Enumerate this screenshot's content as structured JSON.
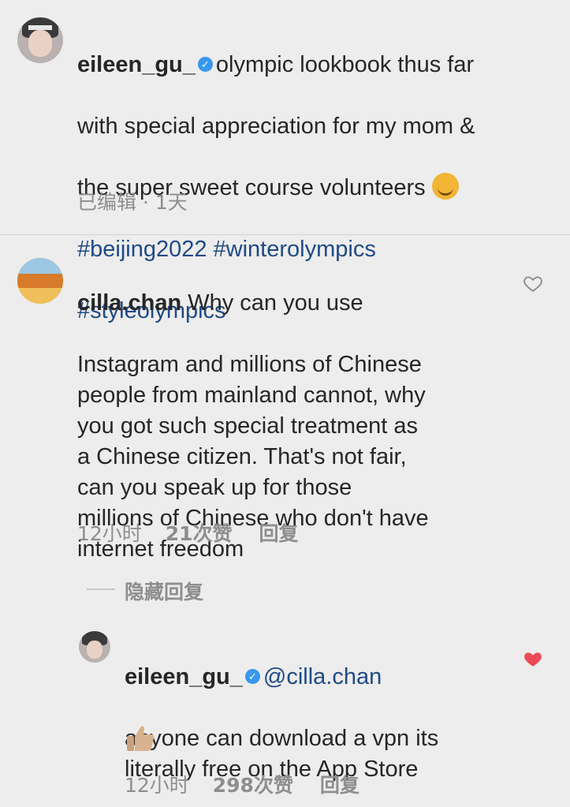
{
  "post": {
    "username": "eileen_gu_",
    "verified_icon": "verified-badge-icon",
    "caption_text": "olympic lookbook thus far",
    "caption_line2": "with special appreciation for my mom &",
    "caption_line3": "the super sweet course volunteers",
    "emoji": "smiling-face-with-hearts-emoji",
    "hashtag_line1": "#beijing2022 #winterolympics",
    "hashtag_line2": "#styleolympics",
    "meta": "已编辑 · 1天"
  },
  "comment": {
    "username": "cilla.chan",
    "text_line1": "Why can you use",
    "text_rest": "Instagram and millions of Chinese\npeople from mainland cannot, why\nyou got such special treatment as\na Chinese citizen. That's not fair,\ncan you speak up for those\nmillions of Chinese who don't have\ninternet freedom",
    "time": "12小时",
    "likes": "21次赞",
    "reply_label": "回复",
    "like_icon": "heart-outline-icon",
    "hide_replies_label": "隐藏回复"
  },
  "reply": {
    "username": "eileen_gu_",
    "verified_icon": "verified-badge-icon",
    "mention": "@cilla.chan",
    "text": "anyone can download a vpn its\nliterally free on the App Store",
    "emoji": "thumbs-up-emoji",
    "time": "12小时",
    "likes": "298次赞",
    "reply_label": "回复",
    "like_icon": "heart-filled-icon",
    "heart_color": "#ed4956"
  }
}
